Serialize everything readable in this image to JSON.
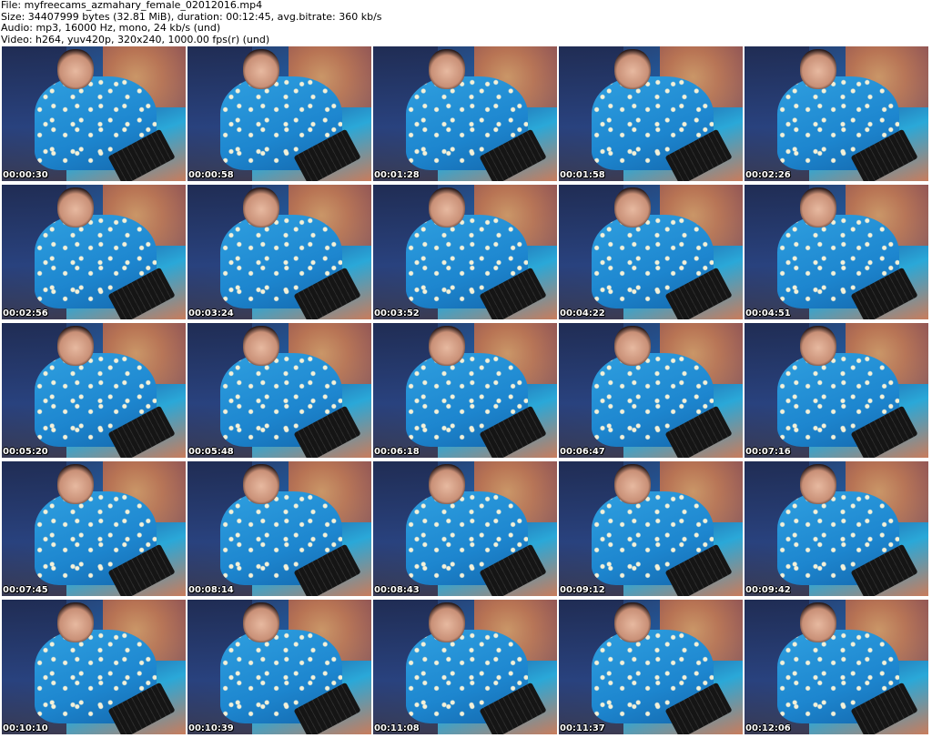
{
  "header": {
    "file_line": "File: myfreecams_azmahary_female_02012016.mp4",
    "size_line": "Size: 34407999 bytes (32.81 MiB), duration: 00:12:45, avg.bitrate: 360 kb/s",
    "audio_line": "Audio: mp3, 16000 Hz, mono, 24 kb/s (und)",
    "video_line": "Video: h264, yuv420p, 320x240, 1000.00 fps(r) (und)"
  },
  "thumbnails": [
    {
      "timestamp": "00:00:30"
    },
    {
      "timestamp": "00:00:58"
    },
    {
      "timestamp": "00:01:28"
    },
    {
      "timestamp": "00:01:58"
    },
    {
      "timestamp": "00:02:26"
    },
    {
      "timestamp": "00:02:56"
    },
    {
      "timestamp": "00:03:24"
    },
    {
      "timestamp": "00:03:52"
    },
    {
      "timestamp": "00:04:22"
    },
    {
      "timestamp": "00:04:51"
    },
    {
      "timestamp": "00:05:20"
    },
    {
      "timestamp": "00:05:48"
    },
    {
      "timestamp": "00:06:18"
    },
    {
      "timestamp": "00:06:47"
    },
    {
      "timestamp": "00:07:16"
    },
    {
      "timestamp": "00:07:45"
    },
    {
      "timestamp": "00:08:14"
    },
    {
      "timestamp": "00:08:43"
    },
    {
      "timestamp": "00:09:12"
    },
    {
      "timestamp": "00:09:42"
    },
    {
      "timestamp": "00:10:10"
    },
    {
      "timestamp": "00:10:39"
    },
    {
      "timestamp": "00:11:08"
    },
    {
      "timestamp": "00:11:37"
    },
    {
      "timestamp": "00:12:06"
    }
  ]
}
